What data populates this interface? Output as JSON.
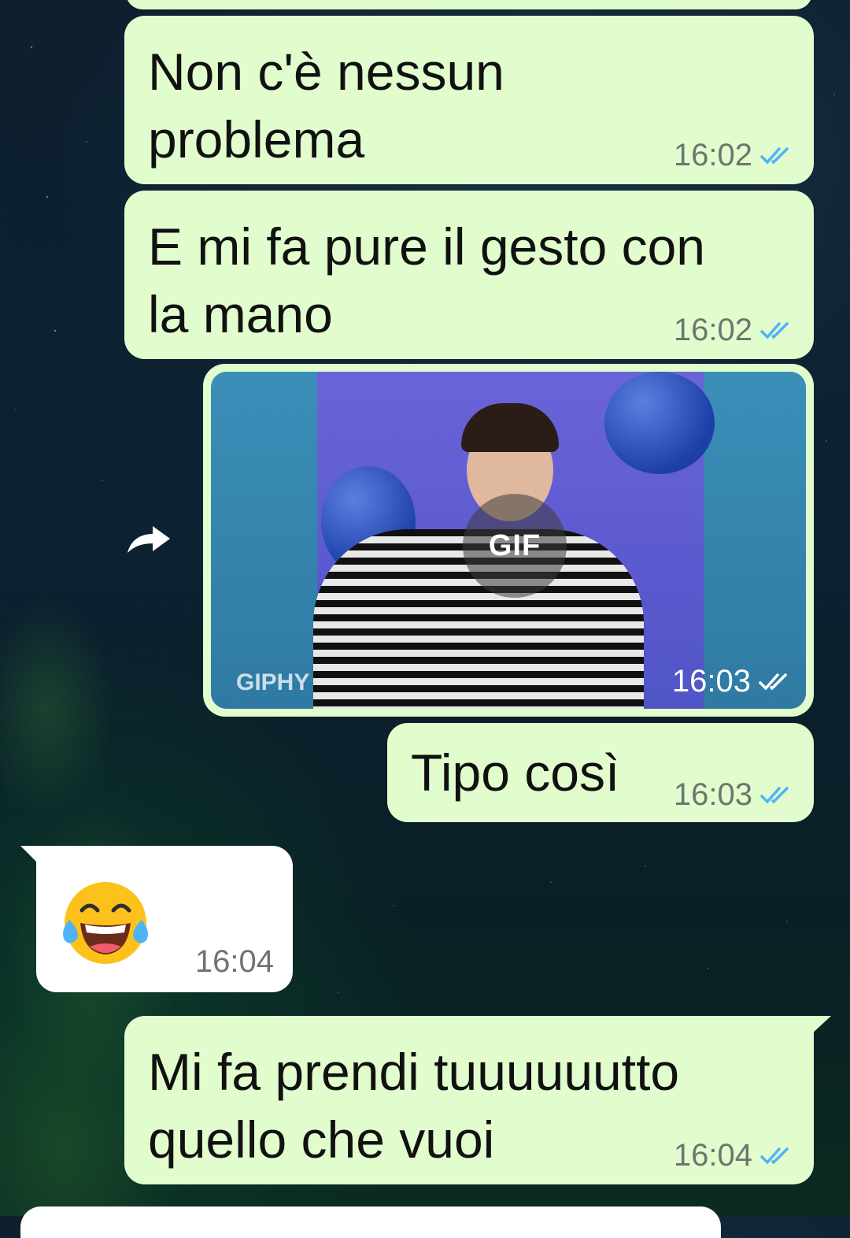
{
  "colors": {
    "outgoing_bubble": "#e2fdcd",
    "incoming_bubble": "#ffffff",
    "read_ticks": "#4fb3f6",
    "timestamp": "#6d7570"
  },
  "messages": [
    {
      "text_line1": "Non c'è nessun",
      "text_line2": "problema",
      "time": "16:02",
      "status_icon": "double-check-read-icon"
    },
    {
      "text_line1": "E mi fa pure il gesto con",
      "text_line2": "la mano",
      "time": "16:02",
      "status_icon": "double-check-read-icon"
    },
    {
      "media_badge": "GIF",
      "watermark": "GIPHY",
      "time": "16:03",
      "forward_icon": "forward-arrow-icon",
      "status_icon": "double-check-read-icon"
    },
    {
      "text": "Tipo così",
      "time": "16:03",
      "status_icon": "double-check-read-icon"
    },
    {
      "emoji": "face-with-tears-of-joy",
      "time": "16:04"
    },
    {
      "text_line1": "Mi fa prendi tuuuuuutto",
      "text_line2": "quello che vuoi",
      "time": "16:04",
      "status_icon": "double-check-read-icon"
    }
  ]
}
